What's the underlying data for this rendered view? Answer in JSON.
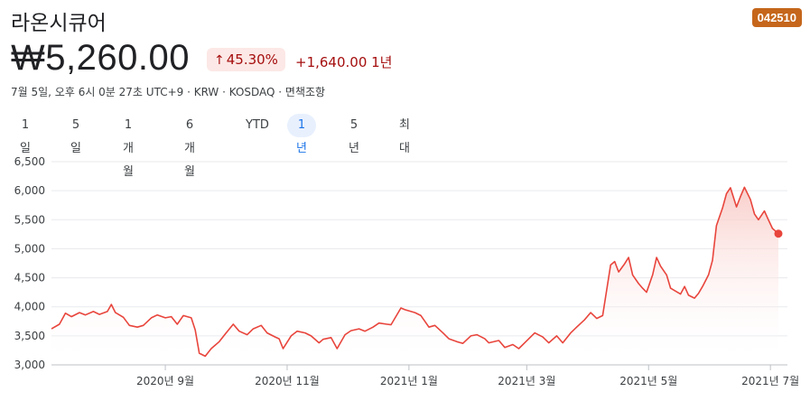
{
  "header": {
    "name": "라온시큐어",
    "ticker": "042510",
    "price": "₩5,260.00",
    "change_pct": "45.30%",
    "change_arrow": "↑",
    "change_abs": "+1,640.00 1년",
    "meta": "7월 5일, 오후 6시 0분 27초 UTC+9 · KRW · KOSDAQ · 면책조항"
  },
  "ranges": {
    "items": [
      "1일",
      "5일",
      "1개월",
      "6개월",
      "YTD",
      "1년",
      "5년",
      "최대"
    ],
    "selected": "1년"
  },
  "colors": {
    "line": "#e8453c",
    "fill_top": "#f8c9c5",
    "grid": "#e8eaed",
    "accent": "#1a73e8",
    "loss_gain": "#a50e0e"
  },
  "chart_data": {
    "type": "area",
    "ylim": [
      3000,
      6500
    ],
    "yticks": [
      3000,
      3500,
      4000,
      4500,
      5000,
      5500,
      6000,
      6500
    ],
    "ytick_labels": [
      "3,000",
      "3,500",
      "4,000",
      "4,500",
      "5,000",
      "5,500",
      "6,000",
      "6,500"
    ],
    "xtick_labels": [
      "2020년 9월",
      "2020년 11월",
      "2021년 1월",
      "2021년 3월",
      "2021년 5월",
      "2021년 7월"
    ],
    "xtick_dates": [
      "2020-09-01",
      "2020-11-01",
      "2021-01-01",
      "2021-03-01",
      "2021-05-01",
      "2021-07-01"
    ],
    "x_start": "2020-07-06",
    "x_end": "2021-07-05",
    "series": [
      {
        "points": [
          [
            "2020-07-06",
            3620
          ],
          [
            "2020-07-10",
            3700
          ],
          [
            "2020-07-13",
            3890
          ],
          [
            "2020-07-16",
            3830
          ],
          [
            "2020-07-20",
            3900
          ],
          [
            "2020-07-23",
            3860
          ],
          [
            "2020-07-27",
            3920
          ],
          [
            "2020-07-30",
            3870
          ],
          [
            "2020-08-03",
            3920
          ],
          [
            "2020-08-05",
            4040
          ],
          [
            "2020-08-07",
            3900
          ],
          [
            "2020-08-11",
            3820
          ],
          [
            "2020-08-14",
            3680
          ],
          [
            "2020-08-18",
            3650
          ],
          [
            "2020-08-21",
            3680
          ],
          [
            "2020-08-25",
            3810
          ],
          [
            "2020-08-28",
            3860
          ],
          [
            "2020-09-01",
            3810
          ],
          [
            "2020-09-04",
            3830
          ],
          [
            "2020-09-07",
            3700
          ],
          [
            "2020-09-10",
            3850
          ],
          [
            "2020-09-14",
            3810
          ],
          [
            "2020-09-16",
            3600
          ],
          [
            "2020-09-18",
            3200
          ],
          [
            "2020-09-21",
            3150
          ],
          [
            "2020-09-24",
            3280
          ],
          [
            "2020-09-28",
            3400
          ],
          [
            "2020-10-01",
            3530
          ],
          [
            "2020-10-05",
            3700
          ],
          [
            "2020-10-08",
            3580
          ],
          [
            "2020-10-12",
            3520
          ],
          [
            "2020-10-15",
            3620
          ],
          [
            "2020-10-19",
            3680
          ],
          [
            "2020-10-22",
            3550
          ],
          [
            "2020-10-26",
            3480
          ],
          [
            "2020-10-28",
            3450
          ],
          [
            "2020-10-30",
            3280
          ],
          [
            "2020-11-03",
            3500
          ],
          [
            "2020-11-06",
            3580
          ],
          [
            "2020-11-10",
            3550
          ],
          [
            "2020-11-13",
            3500
          ],
          [
            "2020-11-17",
            3380
          ],
          [
            "2020-11-19",
            3440
          ],
          [
            "2020-11-23",
            3470
          ],
          [
            "2020-11-26",
            3280
          ],
          [
            "2020-11-30",
            3520
          ],
          [
            "2020-12-03",
            3590
          ],
          [
            "2020-12-07",
            3620
          ],
          [
            "2020-12-10",
            3580
          ],
          [
            "2020-12-14",
            3650
          ],
          [
            "2020-12-17",
            3720
          ],
          [
            "2020-12-21",
            3700
          ],
          [
            "2020-12-23",
            3690
          ],
          [
            "2020-12-28",
            3980
          ],
          [
            "2020-12-30",
            3950
          ],
          [
            "2021-01-04",
            3900
          ],
          [
            "2021-01-07",
            3850
          ],
          [
            "2021-01-11",
            3650
          ],
          [
            "2021-01-14",
            3680
          ],
          [
            "2021-01-18",
            3550
          ],
          [
            "2021-01-21",
            3450
          ],
          [
            "2021-01-25",
            3400
          ],
          [
            "2021-01-28",
            3370
          ],
          [
            "2021-02-01",
            3500
          ],
          [
            "2021-02-04",
            3520
          ],
          [
            "2021-02-08",
            3450
          ],
          [
            "2021-02-10",
            3380
          ],
          [
            "2021-02-15",
            3420
          ],
          [
            "2021-02-18",
            3300
          ],
          [
            "2021-02-22",
            3350
          ],
          [
            "2021-02-25",
            3280
          ],
          [
            "2021-03-02",
            3450
          ],
          [
            "2021-03-05",
            3550
          ],
          [
            "2021-03-09",
            3480
          ],
          [
            "2021-03-12",
            3380
          ],
          [
            "2021-03-16",
            3500
          ],
          [
            "2021-03-19",
            3380
          ],
          [
            "2021-03-23",
            3550
          ],
          [
            "2021-03-26",
            3650
          ],
          [
            "2021-03-30",
            3780
          ],
          [
            "2021-04-02",
            3900
          ],
          [
            "2021-04-05",
            3800
          ],
          [
            "2021-04-08",
            3850
          ],
          [
            "2021-04-12",
            4720
          ],
          [
            "2021-04-14",
            4780
          ],
          [
            "2021-04-16",
            4600
          ],
          [
            "2021-04-19",
            4740
          ],
          [
            "2021-04-21",
            4850
          ],
          [
            "2021-04-23",
            4550
          ],
          [
            "2021-04-26",
            4400
          ],
          [
            "2021-04-28",
            4320
          ],
          [
            "2021-04-30",
            4250
          ],
          [
            "2021-05-03",
            4550
          ],
          [
            "2021-05-05",
            4850
          ],
          [
            "2021-05-07",
            4700
          ],
          [
            "2021-05-10",
            4550
          ],
          [
            "2021-05-12",
            4320
          ],
          [
            "2021-05-14",
            4280
          ],
          [
            "2021-05-17",
            4220
          ],
          [
            "2021-05-19",
            4350
          ],
          [
            "2021-05-21",
            4200
          ],
          [
            "2021-05-24",
            4150
          ],
          [
            "2021-05-26",
            4230
          ],
          [
            "2021-05-28",
            4350
          ],
          [
            "2021-05-31",
            4550
          ],
          [
            "2021-06-02",
            4800
          ],
          [
            "2021-06-04",
            5400
          ],
          [
            "2021-06-07",
            5700
          ],
          [
            "2021-06-09",
            5950
          ],
          [
            "2021-06-11",
            6050
          ],
          [
            "2021-06-14",
            5720
          ],
          [
            "2021-06-16",
            5900
          ],
          [
            "2021-06-18",
            6060
          ],
          [
            "2021-06-21",
            5850
          ],
          [
            "2021-06-23",
            5600
          ],
          [
            "2021-06-25",
            5500
          ],
          [
            "2021-06-28",
            5650
          ],
          [
            "2021-06-30",
            5500
          ],
          [
            "2021-07-02",
            5350
          ],
          [
            "2021-07-05",
            5260
          ]
        ]
      }
    ]
  }
}
